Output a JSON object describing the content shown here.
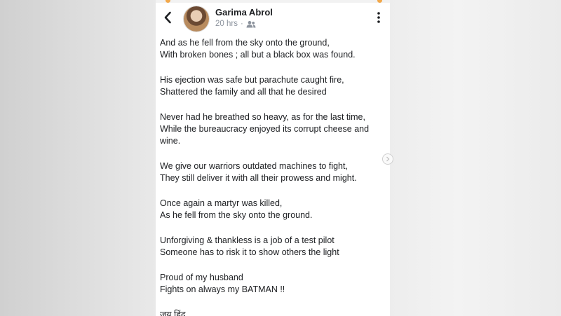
{
  "post": {
    "author": "Garima Abrol",
    "time": "20 hrs",
    "separator": "·",
    "icons": {
      "back": "chevron-left-icon",
      "audience": "friends-icon",
      "menu": "more-vertical-icon"
    },
    "stanzas": [
      [
        "And as he fell from the sky onto the ground,",
        "With broken bones ; all but a black box was found."
      ],
      [
        "His ejection was safe but parachute caught fire,",
        "Shattered the family and all that he desired"
      ],
      [
        "Never had he breathed so heavy, as for the last time,",
        "While the bureaucracy enjoyed its corrupt cheese and wine."
      ],
      [
        "We give our warriors outdated machines to fight,",
        "They still deliver it with all their prowess and might."
      ],
      [
        "Once again a martyr was killed,",
        "As he fell from the sky onto the ground."
      ],
      [
        "Unforgiving & thankless is a job of a test pilot",
        "Someone has to risk it to show others the light"
      ],
      [
        "Proud of my husband",
        "Fights on always my BATMAN !!"
      ],
      [
        "जय हिंद"
      ]
    ]
  },
  "colors": {
    "text": "#1c1e21",
    "meta": "#8d949e",
    "accent_dot": "#f2a84a"
  }
}
